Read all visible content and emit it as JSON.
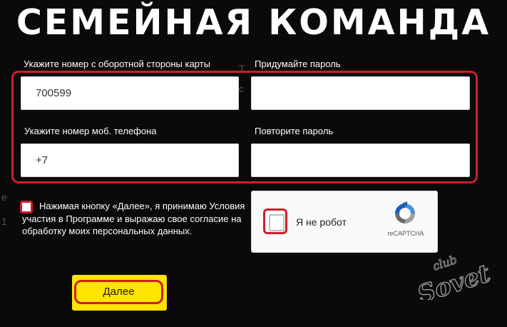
{
  "page": {
    "title": "СЕМЕЙНАЯ КОМАНДА"
  },
  "form": {
    "card_number": {
      "label": "Укажите номер с оборотной стороны карты",
      "value": "700599"
    },
    "password": {
      "label": "Придумайте пароль",
      "value": ""
    },
    "phone": {
      "label": "Укажите номер моб. телефона",
      "value": "+7"
    },
    "password_repeat": {
      "label": "Повторите пароль",
      "value": ""
    },
    "consent": {
      "text": "Нажимая кнопку «Далее», я принимаю Условия участия в Программе и выражаю свое согласие на обработку моих персональных данных.",
      "checked": false
    },
    "captcha": {
      "label": "Я не робот",
      "brand": "reCAPTCHA",
      "checked": false
    },
    "next_button": {
      "label": "Далее"
    }
  },
  "watermark": {
    "line1": "club",
    "line2": "Sovet"
  },
  "colors": {
    "background": "#0a0a0a",
    "highlight_red": "#cc1f2d",
    "button_yellow": "#ffe400",
    "field_white": "#ffffff"
  },
  "icons": {
    "captcha_logo": "recaptcha-icon"
  }
}
